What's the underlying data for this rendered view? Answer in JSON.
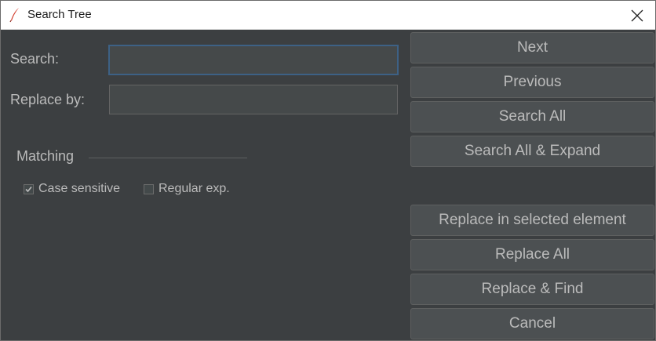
{
  "window": {
    "title": "Search Tree",
    "app_icon": "feather-icon",
    "close_icon": "close-icon"
  },
  "form": {
    "search_label": "Search:",
    "search_value": "",
    "replace_label": "Replace by:",
    "replace_value": ""
  },
  "matching": {
    "label": "Matching",
    "case_sensitive": {
      "label": "Case sensitive",
      "checked": true
    },
    "regular_exp": {
      "label": "Regular exp.",
      "checked": false
    }
  },
  "buttons": {
    "next": "Next",
    "previous": "Previous",
    "search_all": "Search All",
    "search_all_expand": "Search All & Expand",
    "replace_selected": "Replace in selected element",
    "replace_all": "Replace All",
    "replace_find": "Replace & Find",
    "cancel": "Cancel"
  },
  "colors": {
    "background": "#3c3f41",
    "text": "#bbbbbb",
    "button": "#4c5052",
    "focus": "#3d6185"
  }
}
